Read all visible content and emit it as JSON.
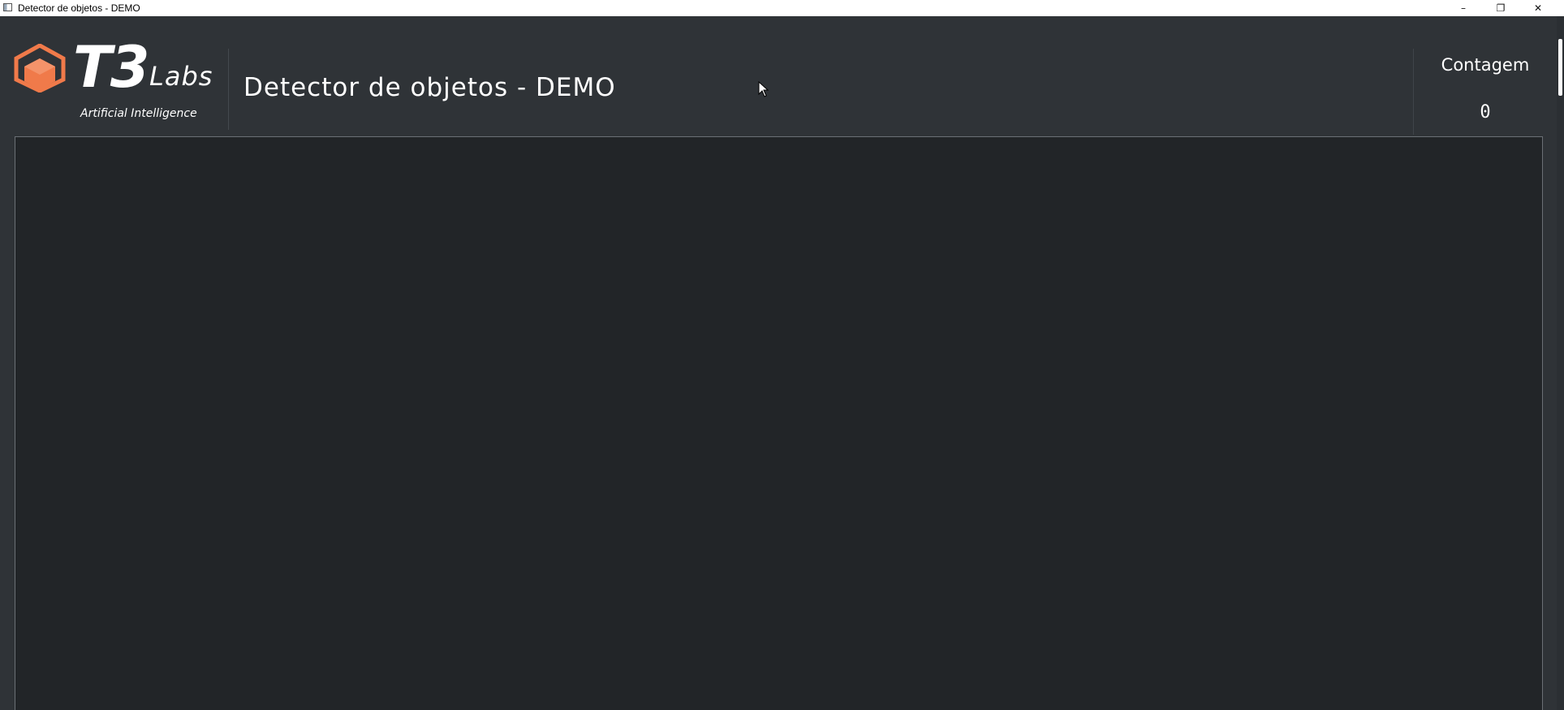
{
  "window": {
    "title": "Detector de objetos - DEMO",
    "controls": {
      "minimize": "–",
      "maximize": "❐",
      "close": "✕"
    }
  },
  "header": {
    "logo": {
      "brand": "T3",
      "brand_suffix": "Labs",
      "tagline": "Artificial Intelligence",
      "icon": "orange-cube-icon",
      "accent_color": "#f07a4a"
    },
    "title": "Detector de objetos - DEMO",
    "count": {
      "label": "Contagem",
      "value": "0"
    }
  },
  "colors": {
    "background": "#2f3337",
    "panel": "#222528",
    "text": "#ffffff"
  }
}
